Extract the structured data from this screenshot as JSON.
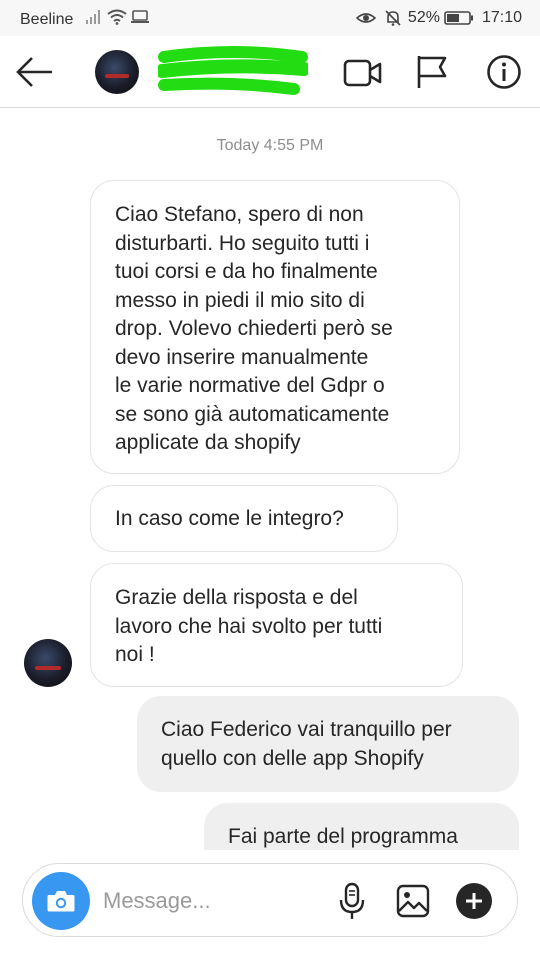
{
  "status_bar": {
    "carrier": "Beeline",
    "battery": "52%",
    "time": "17:10",
    "icons": [
      "signal-icon",
      "wifi-icon",
      "screen-icon",
      "eye-icon",
      "mute-bell-icon",
      "battery-icon"
    ]
  },
  "header": {
    "back_icon": "arrow-left-icon",
    "avatar": "profile-avatar",
    "username_redacted_color": "#22dd11",
    "actions": [
      "video-call-icon",
      "flag-icon",
      "info-icon"
    ]
  },
  "thread": {
    "timestamp": "Today 4:55 PM",
    "messages": [
      {
        "direction": "in",
        "text": "Ciao Stefano, spero di non\ndisturbarti. Ho seguito tutti i\ntuoi corsi e da ho finalmente\nmesso in piedi il mio sito di\ndrop. Volevo chiederti però se\ndevo inserire manualmente\nle varie normative del Gdpr o\nse sono già automaticamente\napplicate da shopify"
      },
      {
        "direction": "in",
        "text": "In caso come le integro?"
      },
      {
        "direction": "in",
        "text": "Grazie della risposta e del\nlavoro  che hai svolto per  tutti\nnoi !"
      },
      {
        "direction": "out",
        "text": "Ciao Federico vai tranquillo per\nquello con delle app Shopify"
      },
      {
        "direction": "out",
        "text": "Fai parte del programma"
      }
    ]
  },
  "composer": {
    "placeholder": "Message...",
    "camera_icon": "camera-icon",
    "mic_icon": "microphone-icon",
    "gallery_icon": "gallery-icon",
    "plus_icon": "plus-icon",
    "accent_color": "#3897f0"
  }
}
